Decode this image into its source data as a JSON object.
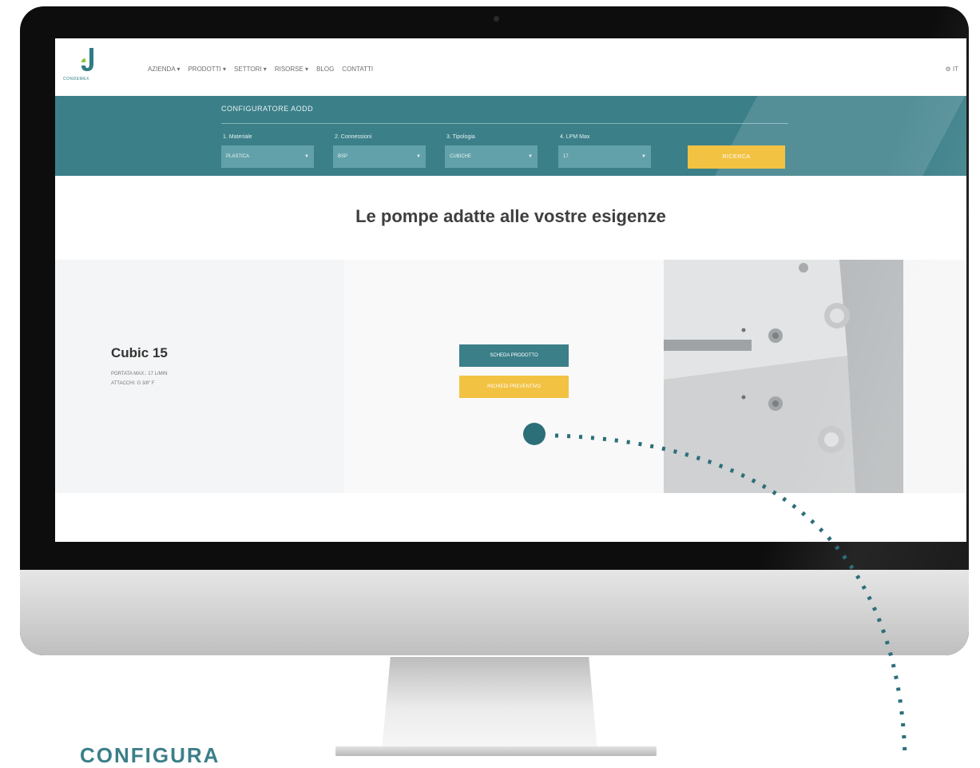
{
  "nav": {
    "brand": "CONDEMEX",
    "items": [
      "AZIENDA ▾",
      "PRODOTTI ▾",
      "SETTORI ▾",
      "RISORSE ▾",
      "BLOG",
      "CONTATTI"
    ],
    "lang": "⚙ IT"
  },
  "configurator": {
    "title": "CONFIGURATORE AODD",
    "fields": [
      {
        "label": "1. Materiale",
        "value": "PLASTICA"
      },
      {
        "label": "2. Connessioni",
        "value": "BSP"
      },
      {
        "label": "3. Tipologia",
        "value": "CUBICHE"
      },
      {
        "label": "4. LPM Max",
        "value": "17"
      }
    ],
    "search_label": "RICERCA"
  },
  "headline": "Le pompe adatte alle vostre esigenze",
  "product": {
    "name": "Cubic 15",
    "spec1": "PORTATA MAX.: 17 L/MIN",
    "spec2": "ATTACCHI: G 3/8\" F",
    "sheet_button": "SCHEDA PRODOTTO",
    "quote_button": "RICHIEDI PREVENTIVO"
  },
  "caption": "CONFIGURA",
  "colors": {
    "teal": "#3b7f89",
    "yellow": "#f2c243",
    "dark": "#0d0d0d"
  }
}
